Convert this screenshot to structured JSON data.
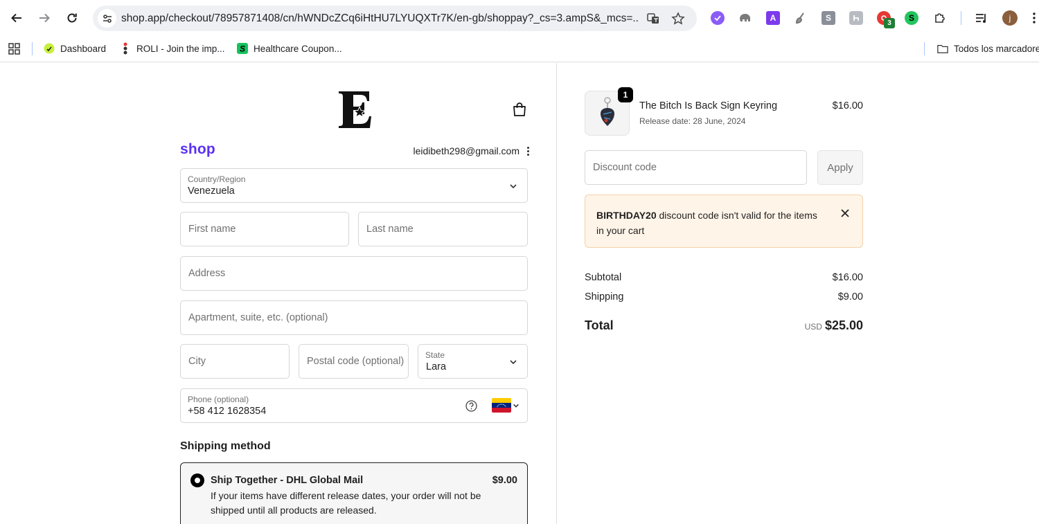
{
  "browser": {
    "url": "shop.app/checkout/78957871408/cn/hWNDcZCq6iHtHU7LYUQXTr7K/en-gb/shoppay?_cs=3.ampS&_mcs=...",
    "extension_badge": "3",
    "profile_initial": "j",
    "extensions": [
      {
        "name": "A",
        "color": "#7c3aed"
      },
      {
        "name": "S",
        "color": "#8a8f98"
      },
      {
        "name": "S",
        "color": "#22c55e"
      }
    ]
  },
  "bookmarks": {
    "items": [
      {
        "label": "Dashboard"
      },
      {
        "label": "ROLI - Join the imp..."
      },
      {
        "label": "Healthcare Coupon..."
      }
    ],
    "folder": "Todos los marcadores"
  },
  "checkout": {
    "shop_brand": "shop",
    "email": "leidibeth298@gmail.com",
    "country": {
      "label": "Country/Region",
      "value": "Venezuela"
    },
    "first_name": {
      "placeholder": "First name"
    },
    "last_name": {
      "placeholder": "Last name"
    },
    "address": {
      "placeholder": "Address"
    },
    "apartment": {
      "placeholder": "Apartment, suite, etc. (optional)"
    },
    "city": {
      "placeholder": "City"
    },
    "postal": {
      "placeholder": "Postal code (optional)"
    },
    "state": {
      "label": "State",
      "value": "Lara"
    },
    "phone": {
      "label": "Phone (optional)",
      "value": "+58 412 1628354"
    },
    "shipping": {
      "title": "Shipping method",
      "option_name": "Ship Together - DHL Global Mail",
      "option_price": "$9.00",
      "option_desc": "If your items have different release dates, your order will not be shipped until all products are released."
    }
  },
  "summary": {
    "product": {
      "name": "The Bitch Is Back Sign Keyring",
      "release": "Release date: 28 June, 2024",
      "price": "$16.00",
      "qty": "1"
    },
    "discount": {
      "placeholder": "Discount code",
      "apply_label": "Apply"
    },
    "alert": {
      "code": "BIRTHDAY20",
      "message": "discount code isn't valid for the items in your cart"
    },
    "subtotal": {
      "label": "Subtotal",
      "value": "$16.00"
    },
    "shipping": {
      "label": "Shipping",
      "value": "$9.00"
    },
    "total": {
      "label": "Total",
      "currency": "USD",
      "value": "$25.00"
    }
  },
  "colors": {
    "shop_purple": "#5a31f4",
    "alert_bg": "#fff4e8",
    "alert_border": "#f3d3a8"
  }
}
